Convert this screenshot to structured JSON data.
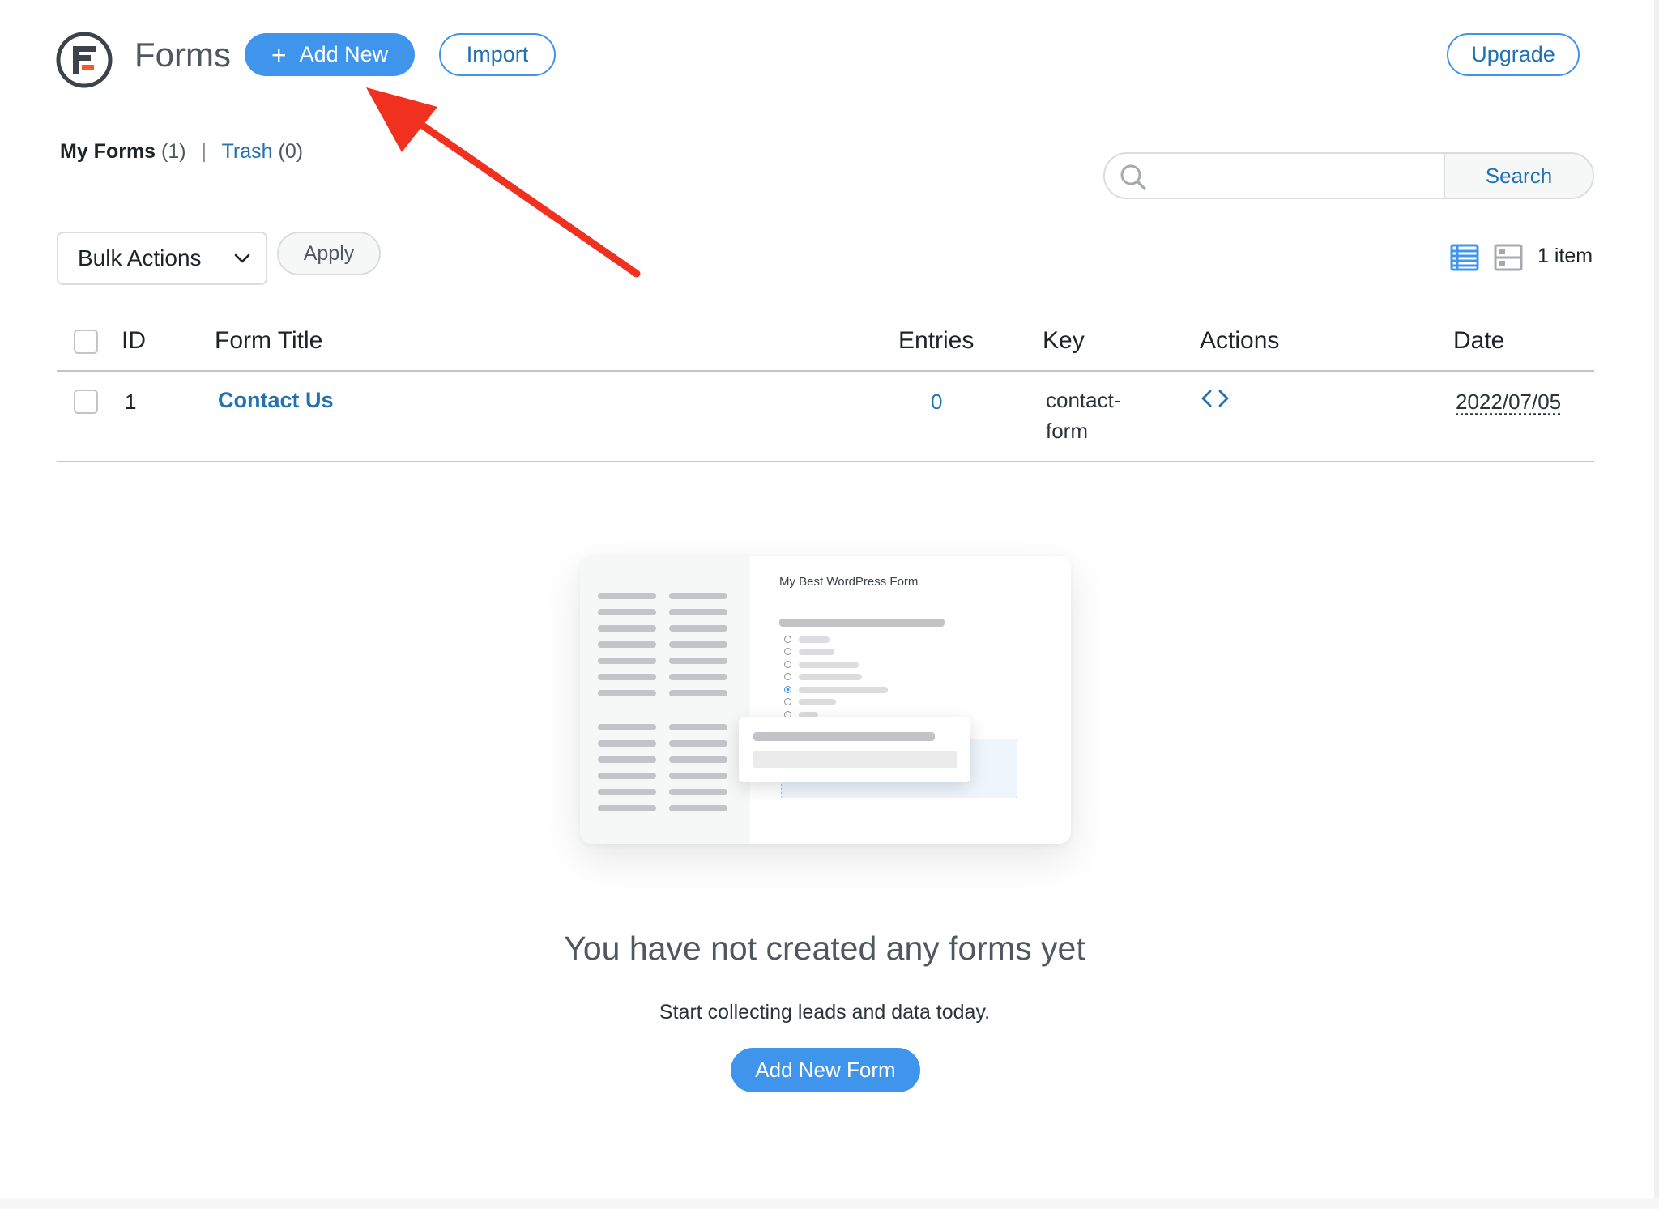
{
  "header": {
    "title": "Forms",
    "add_new_label": "Add New",
    "add_new_icon": "+",
    "import_label": "Import",
    "upgrade_label": "Upgrade"
  },
  "views": {
    "my_forms_label": "My Forms",
    "my_forms_count": "(1)",
    "separator": "|",
    "trash_label": "Trash",
    "trash_count": "(0)"
  },
  "search": {
    "placeholder": "",
    "value": "",
    "button_label": "Search",
    "icon": "search-icon"
  },
  "bulk": {
    "select_value": "Bulk Actions",
    "apply_label": "Apply"
  },
  "pagination": {
    "item_count": "1 item"
  },
  "table": {
    "columns": [
      "ID",
      "Form Title",
      "Entries",
      "Key",
      "Actions",
      "Date"
    ],
    "rows": [
      {
        "id": "1",
        "title": "Contact Us",
        "entries": "0",
        "key_line1": "contact-",
        "key_line2": "form",
        "actions_icon": "code-icon",
        "date": "2022/07/05"
      }
    ]
  },
  "illustration": {
    "form_title": "My Best WordPress Form"
  },
  "empty_state": {
    "title": "You have not created any forms yet",
    "subtitle": "Start collecting leads and data today.",
    "button_label": "Add New Form"
  },
  "colors": {
    "accent": "#3f94eb",
    "link": "#2271b1",
    "annotation_arrow": "#f0311f"
  }
}
